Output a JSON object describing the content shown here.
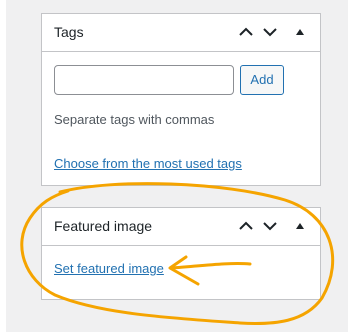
{
  "tags_panel": {
    "title": "Tags",
    "input_value": "",
    "add_label": "Add",
    "hint": "Separate tags with commas",
    "choose_link": "Choose from the most used tags"
  },
  "featured_panel": {
    "title": "Featured image",
    "set_link": "Set featured image"
  },
  "colors": {
    "annotation": "#f5a400",
    "link": "#2271b1",
    "border": "#c3c4c7"
  },
  "icons": [
    "chevron-up-icon",
    "chevron-down-icon",
    "triangle-up-icon"
  ]
}
